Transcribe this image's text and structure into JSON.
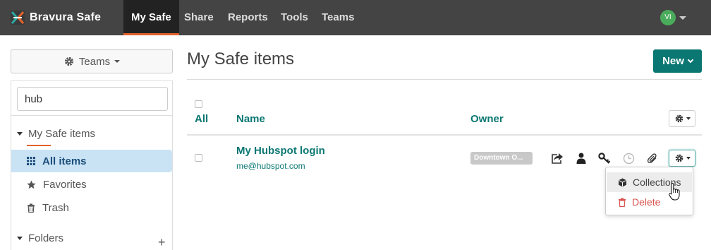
{
  "brand": {
    "name": "Bravura Safe"
  },
  "nav": {
    "items": [
      {
        "label": "My Safe",
        "active": true
      },
      {
        "label": "Share"
      },
      {
        "label": "Reports"
      },
      {
        "label": "Tools"
      },
      {
        "label": "Teams"
      }
    ],
    "avatar_initials": "VI"
  },
  "sidebar": {
    "team_button_label": "Teams",
    "search_value": "hub",
    "tree_heading": "My Safe items",
    "items": [
      {
        "label": "All items",
        "icon": "grid-icon",
        "active": true
      },
      {
        "label": "Favorites",
        "icon": "star-icon"
      },
      {
        "label": "Trash",
        "icon": "trash-icon"
      }
    ],
    "folders_label": "Folders"
  },
  "main": {
    "title": "My Safe items",
    "new_button": "New",
    "columns": {
      "all": "All",
      "name": "Name",
      "owner": "Owner"
    },
    "rows": [
      {
        "name": "My Hubspot login",
        "username": "me@hubspot.com",
        "owner": "Downtown O..."
      }
    ],
    "row_actions": [
      "share-icon",
      "user-icon",
      "key-icon",
      "clock-icon",
      "paperclip-icon",
      "gear-icon"
    ]
  },
  "dropdown": {
    "items": [
      {
        "label": "Collections",
        "icon": "cube-icon"
      },
      {
        "label": "Delete",
        "icon": "trash-icon",
        "color": "#d9534f"
      }
    ]
  },
  "colors": {
    "accent": "#0a7773",
    "nav_bg": "#444444",
    "active_tab_border": "#e2622b",
    "selected_item_bg": "#c9e3f5"
  }
}
